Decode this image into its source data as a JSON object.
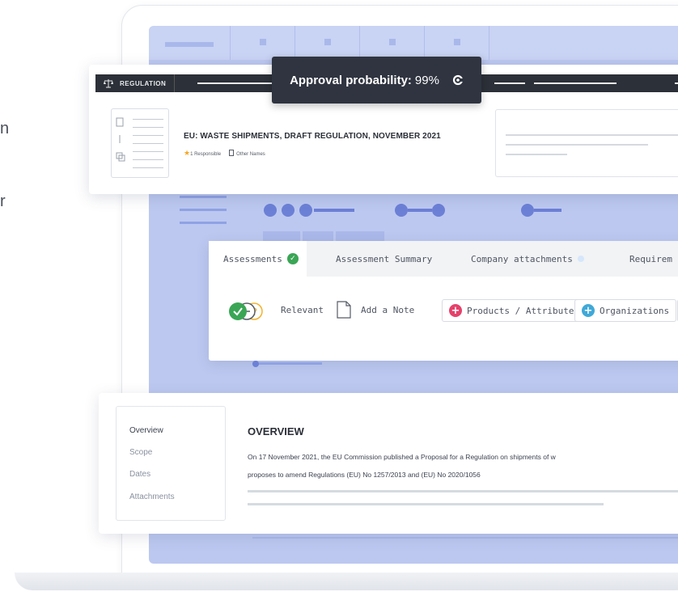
{
  "edge": {
    "char_1": "n",
    "char_2": "r"
  },
  "regulation": {
    "tag": "REGULATION",
    "title": "EU: WASTE SHIPMENTS, DRAFT REGULATION, NOVEMBER 2021",
    "responsible": "1 Responsible",
    "other_names": "Other Names"
  },
  "tooltip": {
    "label": "Approval probability:",
    "value": "99%",
    "icon": "refresh-icon"
  },
  "assessments": {
    "tabs": [
      {
        "label": "Assessments",
        "status": "checked"
      },
      {
        "label": "Assessment Summary"
      },
      {
        "label": "Company attachments"
      },
      {
        "label": "Requirem"
      }
    ],
    "relevant_label": "Relevant",
    "add_note_label": "Add a Note",
    "chips": [
      {
        "label": "Products / Attributes",
        "color": "#e5416a"
      },
      {
        "label": "Organizations",
        "color": "#3fa9d8"
      }
    ]
  },
  "overview": {
    "nav": [
      "Overview",
      "Scope",
      "Dates",
      "Attachments"
    ],
    "title": "OVERVIEW",
    "text_line_1": "On 17 November 2021, the EU Commission published a Proposal for a Regulation on shipments of w",
    "text_line_2": "proposes to amend Regulations (EU) No 1257/2013 and (EU) No 2020/1056"
  },
  "colors": {
    "screen_bg": "#bcc8f0",
    "accent_blue": "#6c80d6",
    "dark": "#2f3440",
    "check_green": "#3aa655",
    "star": "#f3a623"
  }
}
